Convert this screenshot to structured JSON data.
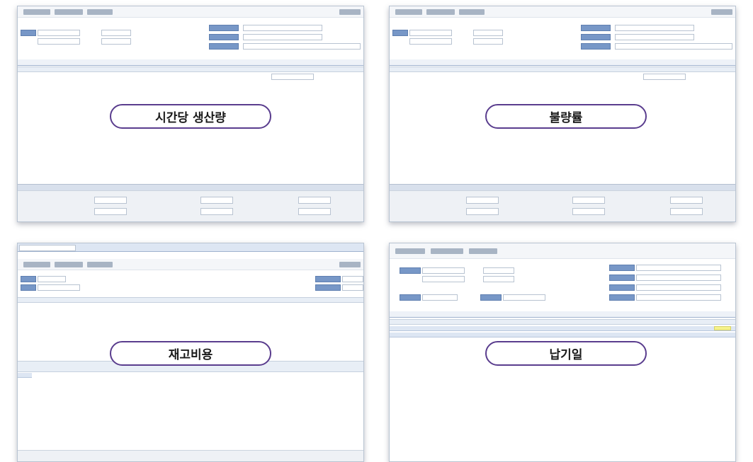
{
  "panels": [
    {
      "caption": "시간당 생산량"
    },
    {
      "caption": "불량률"
    },
    {
      "caption": "재고비용"
    },
    {
      "caption": "납기일"
    }
  ]
}
